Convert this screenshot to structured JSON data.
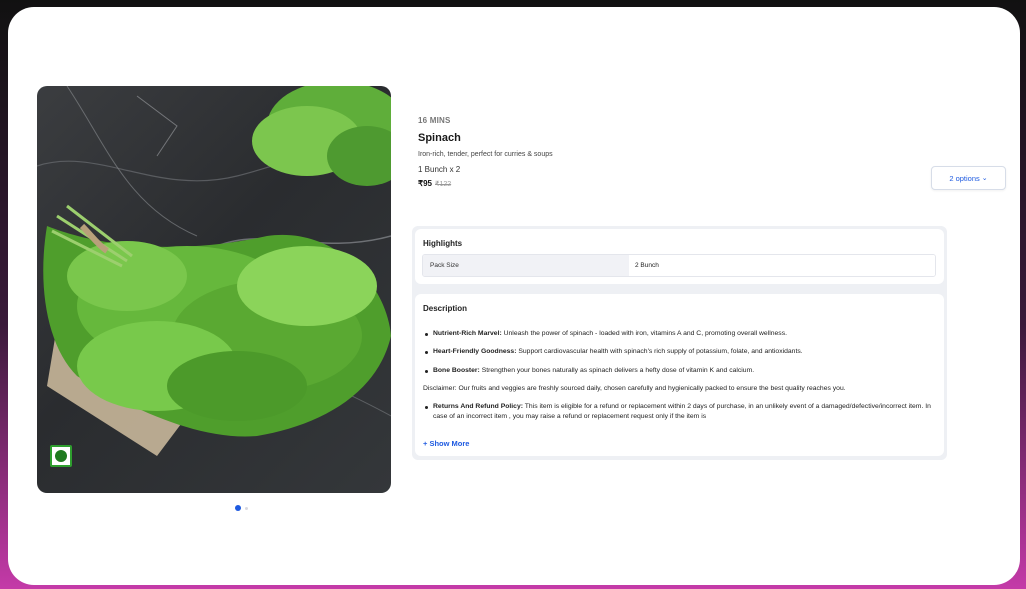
{
  "product": {
    "delivery_time": "16 MINS",
    "name": "Spinach",
    "tagline": "Iron-rich, tender, perfect for curries & soups",
    "quantity": "1 Bunch x 2",
    "price": "₹95",
    "mrp": "₹122",
    "options_label": "2 options",
    "options_icon": "chevron-down-icon"
  },
  "gallery": {
    "active_index": 0,
    "total": 2,
    "veg_badge_color": "#2e9e2e"
  },
  "highlights": {
    "title": "Highlights",
    "rows": [
      {
        "key": "Pack Size",
        "value": "2 Bunch"
      }
    ]
  },
  "description": {
    "title": "Description",
    "bullets": [
      {
        "bold": "Nutrient-Rich Marvel:",
        "text": " Unleash the power of spinach - loaded with iron, vitamins A and C, promoting overall wellness."
      },
      {
        "bold": "Heart-Friendly Goodness:",
        "text": " Support cardiovascular health with spinach's rich supply of potassium, folate, and antioxidants."
      },
      {
        "bold": "Bone Booster:",
        "text": " Strengthen your bones naturally as spinach delivers a hefty dose of vitamin K and calcium."
      }
    ],
    "disclaimer": "Disclaimer: Our fruits and veggies are freshly sourced daily, chosen carefully and hygienically packed to ensure the best quality reaches you.",
    "returns_bold": "Returns And Refund Policy:",
    "returns_text": " This item is eligible for a refund or replacement within 2 days of purchase, in an unlikely event of a damaged/defective/incorrect item. In case of an incorrect item , you may raise a refund or replacement request only if the item is",
    "show_more": "+ Show More"
  },
  "colors": {
    "accent": "#1e5ae0",
    "veg": "#2e9e2e"
  }
}
